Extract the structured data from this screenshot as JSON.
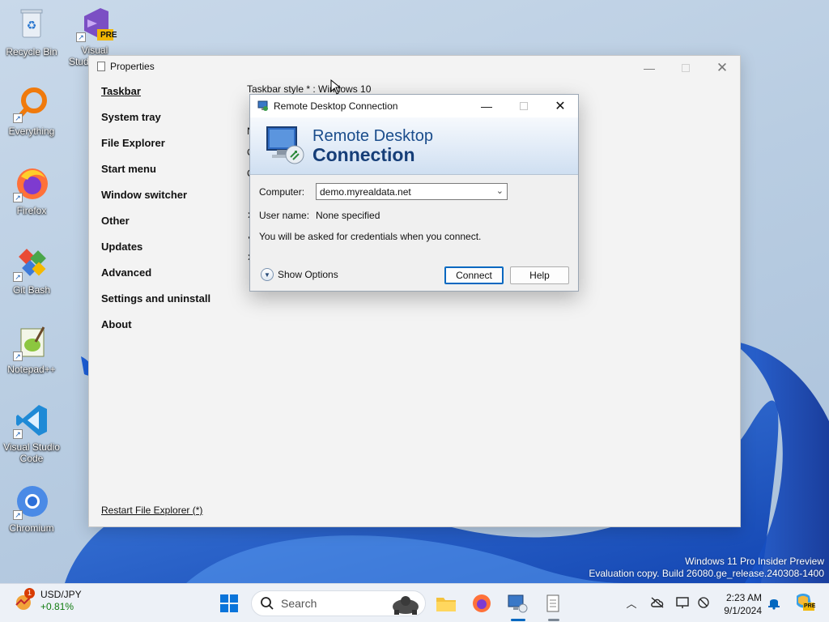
{
  "desktop": {
    "icons": [
      {
        "label": "Recycle Bin"
      },
      {
        "label": "Visual Studio 2022",
        "badge": "PRE"
      },
      {
        "label": "Everything"
      },
      {
        "label": "Firefox"
      },
      {
        "label": "Git Bash"
      },
      {
        "label": "Notepad++"
      },
      {
        "label": "Visual Studio Code"
      },
      {
        "label": "Chromium"
      }
    ]
  },
  "properties": {
    "title": "Properties",
    "nav": [
      "Taskbar",
      "System tray",
      "File Explorer",
      "Start menu",
      "Window switcher",
      "Other",
      "Updates",
      "Advanced",
      "Settings and uninstall",
      "About"
    ],
    "taskbar_style": "Taskbar style * : Windows 10",
    "restart_link": "Restart File Explorer (*)"
  },
  "rdp": {
    "title": "Remote Desktop Connection",
    "banner_line1": "Remote Desktop",
    "banner_line2": "Connection",
    "computer_label": "Computer:",
    "computer_value": "demo.myrealdata.net",
    "username_label": "User name:",
    "username_value": "None specified",
    "info": "You will be asked for credentials when you connect.",
    "show_options": "Show Options",
    "connect": "Connect",
    "help": "Help"
  },
  "watermark": {
    "line1": "Windows 11 Pro Insider Preview",
    "line2": "Evaluation copy. Build 26080.ge_release.240308-1400"
  },
  "taskbar": {
    "widget_ticker": "USD/JPY",
    "widget_change": "+0.81%",
    "widget_badge": "1",
    "search_placeholder": "Search",
    "time": "2:23 AM",
    "date": "9/1/2024",
    "copilot_badge": "PRE"
  },
  "colors": {
    "accent": "#0067c0",
    "rdp_banner_text": "#1b4d8c"
  }
}
